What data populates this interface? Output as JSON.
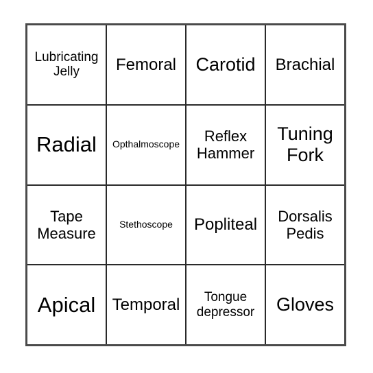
{
  "card": {
    "grid": {
      "rows": 4,
      "columns": 4
    },
    "cells": [
      [
        {
          "label": "Lubricating Jelly",
          "size": "xs"
        },
        {
          "label": "Femoral",
          "size": "md"
        },
        {
          "label": "Carotid",
          "size": "lg"
        },
        {
          "label": "Brachial",
          "size": "md"
        }
      ],
      [
        {
          "label": "Radial",
          "size": "xl"
        },
        {
          "label": "Opthalmoscope",
          "size": "xxs"
        },
        {
          "label": "Reflex Hammer",
          "size": "sm"
        },
        {
          "label": "Tuning Fork",
          "size": "lg"
        }
      ],
      [
        {
          "label": "Tape Measure",
          "size": "sm"
        },
        {
          "label": "Stethoscope",
          "size": "xxs"
        },
        {
          "label": "Popliteal",
          "size": "md"
        },
        {
          "label": "Dorsalis Pedis",
          "size": "sm"
        }
      ],
      [
        {
          "label": "Apical",
          "size": "xl"
        },
        {
          "label": "Temporal",
          "size": "md"
        },
        {
          "label": "Tongue depressor",
          "size": "xs"
        },
        {
          "label": "Gloves",
          "size": "lg"
        }
      ]
    ]
  },
  "colors": {
    "background": "#ffffff",
    "text": "#000000",
    "outer_border": "#4a4a4a",
    "inner_border": "#2a2a2a"
  }
}
